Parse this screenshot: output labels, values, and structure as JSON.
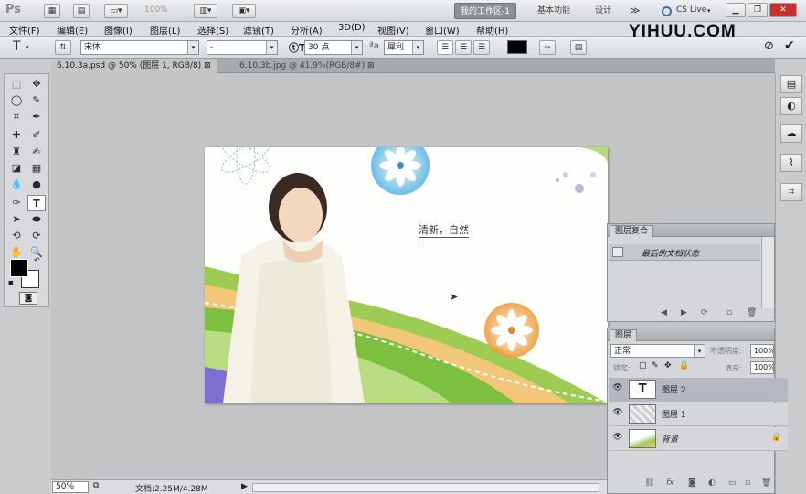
{
  "appbar": {
    "logo": "Ps",
    "zoom_label": "100%",
    "workspaces": [
      "我的工作区-1",
      "基本功能",
      "设计",
      "≫"
    ],
    "cs_live": "CS Live",
    "watermark": "YIHUU.COM"
  },
  "menu": [
    "文件(F)",
    "编辑(E)",
    "图像(I)",
    "图层(L)",
    "选择(S)",
    "滤镜(T)",
    "分析(A)",
    "3D(D)",
    "视图(V)",
    "窗口(W)",
    "帮助(H)"
  ],
  "options": {
    "font_family": "宋体",
    "font_style": "-",
    "font_size": "30 点",
    "aa_label": "a",
    "aa_mode": "犀利"
  },
  "tabs": [
    {
      "label": "6.10.3a.psd @ 50% (图层 1, RGB/8)",
      "close": "⊠"
    },
    {
      "label": "6.10.3b.jpg @ 41.9%(RGB/8#)",
      "close": "⊠"
    }
  ],
  "document": {
    "text": "清新，自然"
  },
  "status": {
    "zoom": "50%",
    "doc_info": "文档:2.25M/4.28M"
  },
  "history_panel": {
    "title": "图层复合",
    "row_label": "最后的文档状态"
  },
  "layers_panel": {
    "title": "图层",
    "blend_mode": "正常",
    "opacity_label": "不透明度:",
    "opacity_value": "100%",
    "lock_label": "锁定:",
    "fill_label": "填充:",
    "fill_value": "100%",
    "layers": [
      {
        "name": "图层 2",
        "type": "text",
        "selected": true
      },
      {
        "name": "图层 1",
        "type": "image",
        "selected": false
      },
      {
        "name": "背景",
        "type": "image",
        "selected": false
      }
    ]
  },
  "icons": {
    "t_icon": "T",
    "type_tool": "T",
    "stats": "fx"
  },
  "colors": {
    "accent_workspace": "#8c8f93",
    "selected_layer": "#b5b8c0",
    "canvas_bg": "#c3c5c6"
  }
}
